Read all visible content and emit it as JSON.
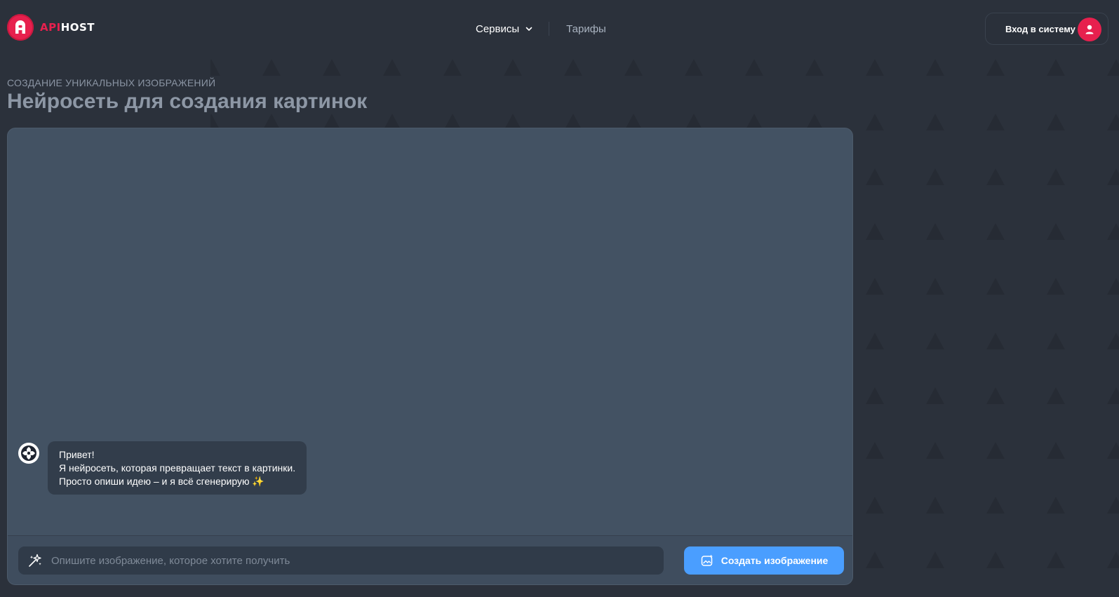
{
  "colors": {
    "brand": "#e7204e",
    "accent": "#4a9eff",
    "background": "#2b313b",
    "panel": "#435263"
  },
  "header": {
    "logo": {
      "part1": "API",
      "part2": "HOST",
      "icon": "apihost-logo-icon"
    },
    "nav": [
      {
        "label": "Сервисы",
        "icon": "chevron-down-icon"
      },
      {
        "label": "Тарифы"
      }
    ],
    "login": {
      "label": "Вход в систему",
      "icon": "user-icon"
    }
  },
  "hero": {
    "subtitle": "СОЗДАНИЕ УНИКАЛЬНЫХ ИЗОБРАЖЕНИЙ",
    "title": "Нейросеть для создания картинок"
  },
  "chat": {
    "messages": [
      {
        "avatar_icon": "ai-logo-icon",
        "lines": [
          "Привет!",
          "Я нейросеть, которая превращает текст в картинки.",
          "Просто опиши идею – и я всё сгенерирую ✨"
        ]
      }
    ]
  },
  "composer": {
    "input_icon": "magic-wand-icon",
    "placeholder": "Опишите изображение, которое хотите получить",
    "value": "",
    "button_label": "Создать изображение",
    "button_icon": "image-create-icon"
  }
}
